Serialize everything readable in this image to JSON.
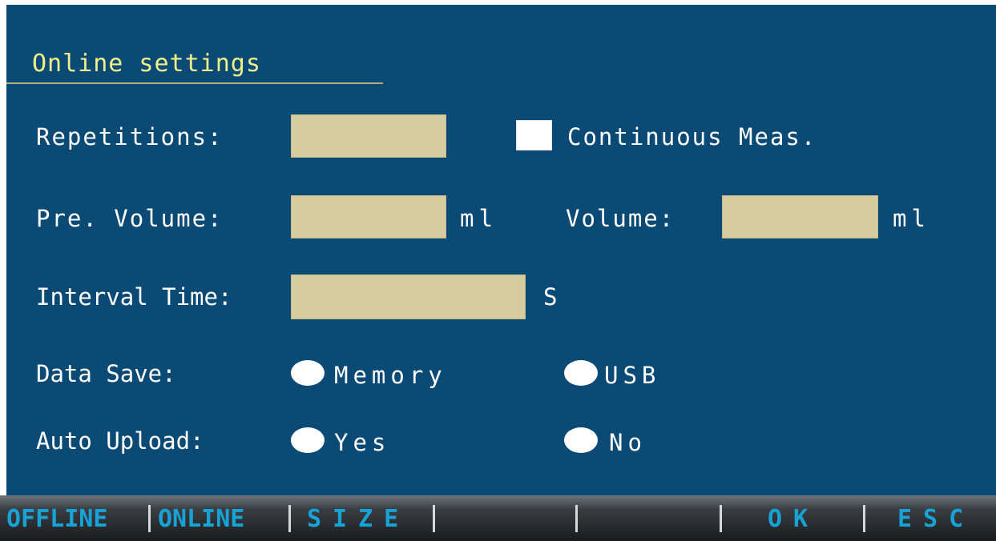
{
  "screen": {
    "title": "Online settings",
    "repetitions": {
      "label": "Repetitions:",
      "value": ""
    },
    "continuous": {
      "label": "Continuous Meas.",
      "checked": false
    },
    "pre_volume": {
      "label": "Pre. Volume:",
      "value": "",
      "unit": "ml"
    },
    "volume": {
      "label": "Volume:",
      "value": "",
      "unit": "ml"
    },
    "interval_time": {
      "label": "Interval Time:",
      "value": "",
      "unit": "S"
    },
    "data_save": {
      "label": "Data Save:",
      "options": [
        "Memory",
        "USB"
      ]
    },
    "auto_upload": {
      "label": "Auto Upload:",
      "options": [
        "Yes",
        "No"
      ]
    }
  },
  "function_keys": [
    "OFFLINE",
    "ONLINE",
    "SIZE",
    "",
    "",
    "OK",
    "ESC"
  ],
  "colors": {
    "background": "#0b4a74",
    "title": "#f0f08a",
    "field": "#d8cc9f",
    "function_key_text": "#18a3d6"
  }
}
